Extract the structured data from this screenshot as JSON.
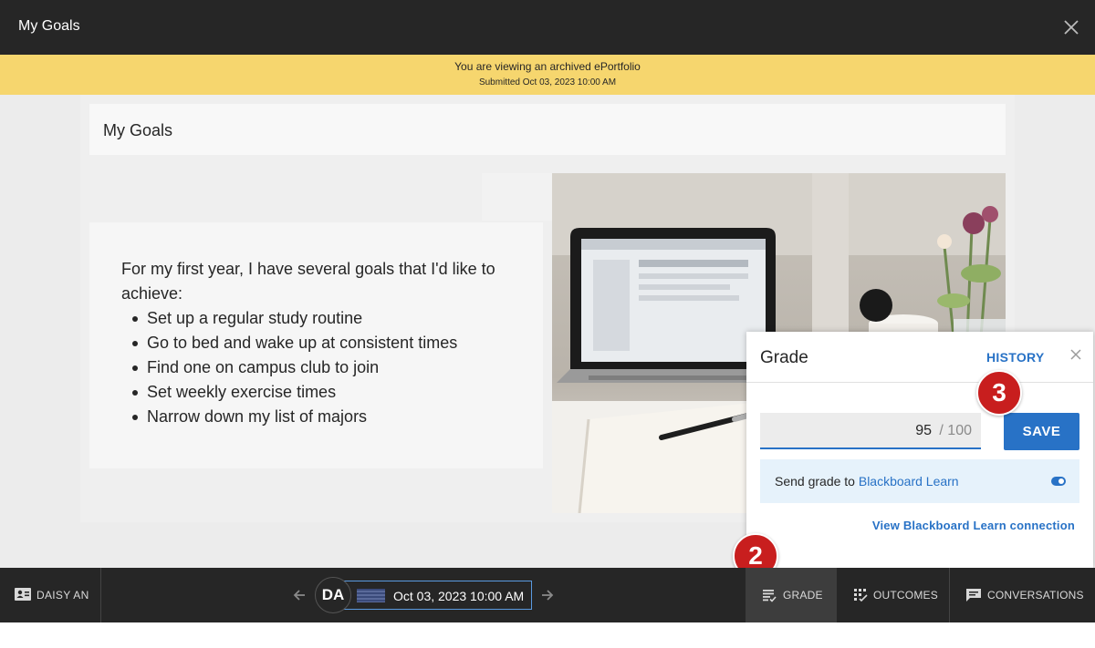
{
  "header": {
    "title": "My Goals"
  },
  "banner": {
    "line1": "You are viewing an archived ePortfolio",
    "line2": "Submitted Oct 03, 2023 10:00 AM"
  },
  "page": {
    "title": "My Goals",
    "intro": "For my first year, I have several goals that I'd like to achieve:",
    "goals": [
      "Set up a regular study routine",
      "Go to bed and wake up at consistent times",
      "Find one on campus club to join",
      "Set weekly exercise times",
      "Narrow down my list of majors"
    ]
  },
  "grade_panel": {
    "title": "Grade",
    "history_label": "HISTORY",
    "grade_value": "95",
    "grade_max": "/ 100",
    "save_label": "SAVE",
    "send_prefix": "Send grade to ",
    "send_target": "Blackboard Learn",
    "view_connection_label": "View Blackboard Learn connection"
  },
  "callouts": {
    "grade_badge": "2",
    "save_badge": "3"
  },
  "footer": {
    "user_name": "DAISY AN",
    "avatar_initials": "DA",
    "submission_date": "Oct 03, 2023 10:00 AM",
    "tabs": {
      "grade": "GRADE",
      "outcomes": "OUTCOMES",
      "conversations": "CONVERSATIONS"
    }
  },
  "colors": {
    "accent": "#2872c6",
    "banner": "#f6d66e",
    "dark": "#262626",
    "callout": "#c81e1e"
  }
}
